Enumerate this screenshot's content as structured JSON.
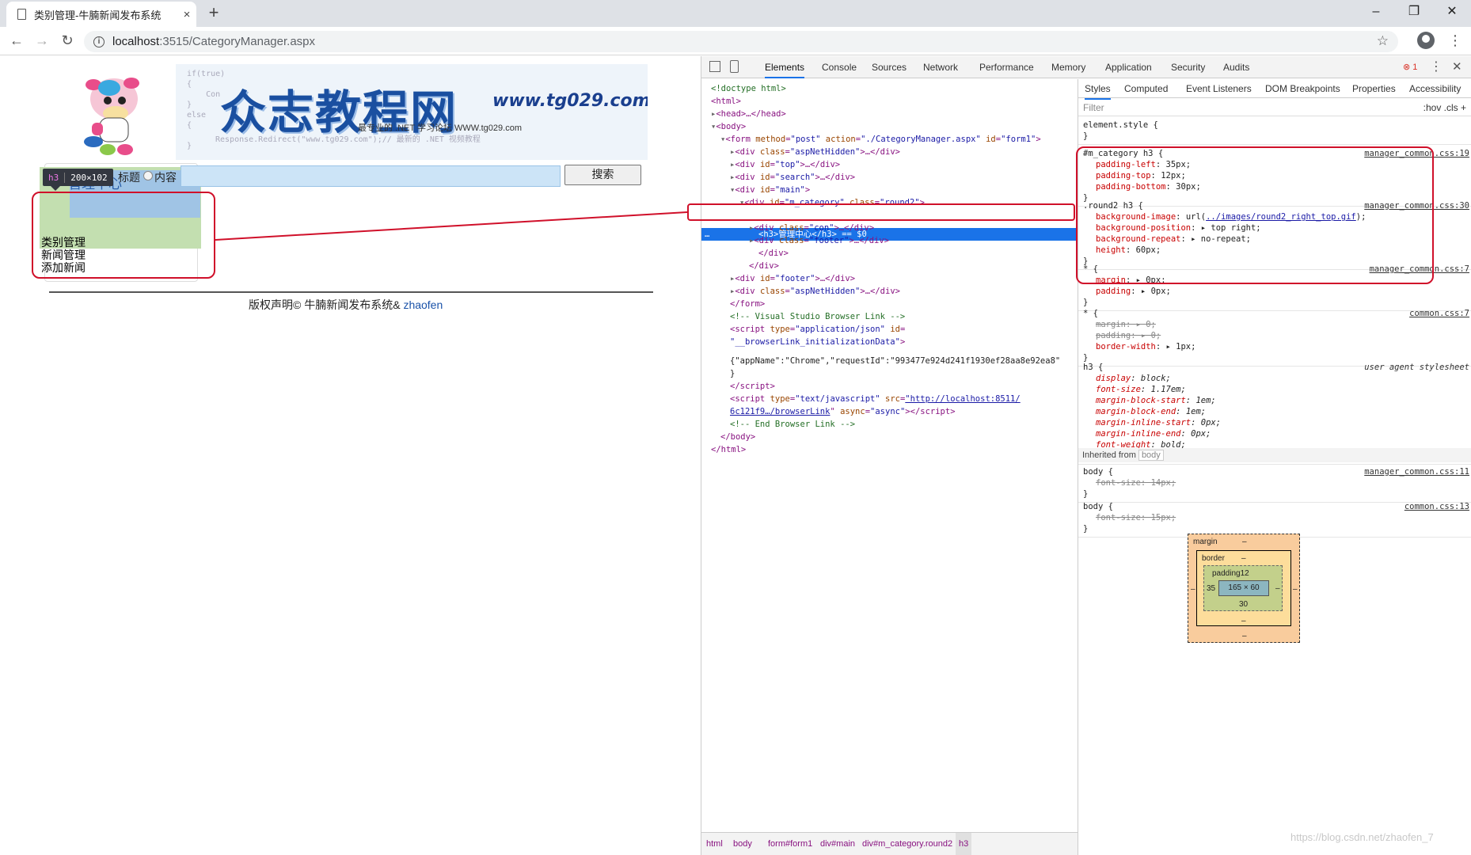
{
  "browser": {
    "tab_title": "类别管理-牛腩新闻发布系统",
    "tab_close": "×",
    "new_tab": "+",
    "url_host": "localhost",
    "url_path": ":3515/CategoryManager.aspx",
    "window_controls": [
      "–",
      "❐",
      "✕"
    ]
  },
  "page": {
    "banner_code": "if(true)\n{\n    Con\n}\nelse\n{\n\n}",
    "banner_title": "众志教程网",
    "banner_url": "www.tg029.com",
    "banner_sub": "最专业的 .NET 学习论坛  WWW.tg029.com",
    "banner_sub2": "Response.Redirect(\"www.tg029.com\");// 最新的 .NET 视频教程",
    "tooltip_tag": "h3",
    "tooltip_dim": "200×102",
    "radio_title_label": "标题",
    "radio_content_label": "内容",
    "search_value": "",
    "search_button": "搜索",
    "category_heading": "管理中心",
    "side_links": [
      "类别管理",
      "新闻管理",
      "添加新闻"
    ],
    "footer_text": "版权声明© 牛腩新闻发布系统& ",
    "footer_link": "zhaofen"
  },
  "devtools": {
    "tabs": [
      "Elements",
      "Console",
      "Sources",
      "Network",
      "Performance",
      "Memory",
      "Application",
      "Security",
      "Audits"
    ],
    "active_tab": "Elements",
    "error_count": "1",
    "breadcrumbs": [
      "html",
      "body",
      "form#form1",
      "div#main",
      "div#m_category.round2",
      "h3"
    ],
    "style_tabs": [
      "Styles",
      "Computed",
      "Event Listeners",
      "DOM Breakpoints",
      "Properties",
      "Accessibility"
    ],
    "filter_placeholder": "Filter",
    "filter_opts": ":hov  .cls  +",
    "inherited_label": "Inherited from",
    "inherited_tag": "body",
    "box_model": {
      "margin_label": "margin",
      "margin_value": "–",
      "border_label": "border",
      "border_value": "–",
      "padding_label": "padding12",
      "content": "165 × 60",
      "padding_left": "35",
      "padding_bottom": "30",
      "dash": "–"
    }
  },
  "colors": {
    "selection": "#1a73e8",
    "annotation_red": "#d0102a",
    "h3_highlight": "#c3dfb0",
    "content_highlight": "#9ec2e8"
  },
  "watermark": "https://blog.csdn.net/zhaofen_7"
}
